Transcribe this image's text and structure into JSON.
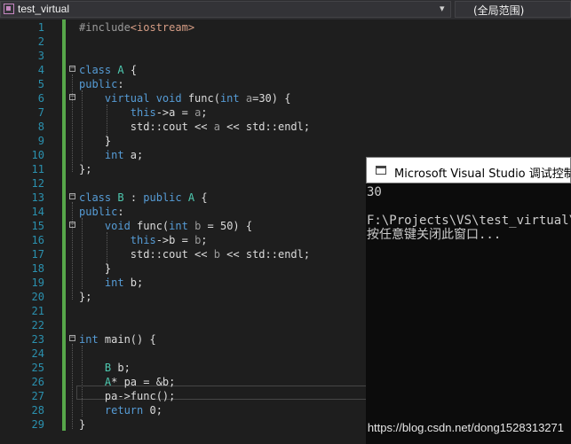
{
  "nav": {
    "file": "test_virtual",
    "scope": "(全局范围)",
    "dropdown_arrow": "▾"
  },
  "editor": {
    "line_numbers": [
      "1",
      "2",
      "3",
      "4",
      "5",
      "6",
      "7",
      "8",
      "9",
      "10",
      "11",
      "12",
      "13",
      "14",
      "15",
      "16",
      "17",
      "18",
      "19",
      "20",
      "21",
      "22",
      "23",
      "24",
      "25",
      "26",
      "27",
      "28",
      "29"
    ],
    "lines": [
      [
        [
          "#include",
          "#9b9b9b"
        ],
        [
          "<iostream>",
          "#d69d85"
        ]
      ],
      [],
      [],
      [
        [
          "class ",
          "#569cd6"
        ],
        [
          "A",
          "#4ec9b0"
        ],
        [
          " {",
          "#dcdcdc"
        ]
      ],
      [
        [
          "public",
          "#569cd6"
        ],
        [
          ":",
          "#dcdcdc"
        ]
      ],
      [
        [
          "    virtual ",
          "#569cd6"
        ],
        [
          "void ",
          "#569cd6"
        ],
        [
          "func(",
          "#dcdcdc"
        ],
        [
          "int ",
          "#569cd6"
        ],
        [
          "a",
          "#9a9a9a"
        ],
        [
          "=30) {",
          "#dcdcdc"
        ]
      ],
      [
        [
          "        this",
          "#569cd6"
        ],
        [
          "->a = ",
          "#dcdcdc"
        ],
        [
          "a",
          "#9a9a9a"
        ],
        [
          ";",
          "#dcdcdc"
        ]
      ],
      [
        [
          "        std::cout << ",
          "#dcdcdc"
        ],
        [
          "a",
          "#9a9a9a"
        ],
        [
          " << std::endl;",
          "#dcdcdc"
        ]
      ],
      [
        [
          "    }",
          "#dcdcdc"
        ]
      ],
      [
        [
          "    int ",
          "#569cd6"
        ],
        [
          "a;",
          "#dcdcdc"
        ]
      ],
      [
        [
          "};",
          "#dcdcdc"
        ]
      ],
      [],
      [
        [
          "class ",
          "#569cd6"
        ],
        [
          "B",
          "#4ec9b0"
        ],
        [
          " : ",
          "#dcdcdc"
        ],
        [
          "public ",
          "#569cd6"
        ],
        [
          "A",
          "#4ec9b0"
        ],
        [
          " {",
          "#dcdcdc"
        ]
      ],
      [
        [
          "public",
          "#569cd6"
        ],
        [
          ":",
          "#dcdcdc"
        ]
      ],
      [
        [
          "    void ",
          "#569cd6"
        ],
        [
          "func(",
          "#dcdcdc"
        ],
        [
          "int ",
          "#569cd6"
        ],
        [
          "b",
          "#9a9a9a"
        ],
        [
          " = 50) {",
          "#dcdcdc"
        ]
      ],
      [
        [
          "        this",
          "#569cd6"
        ],
        [
          "->b = ",
          "#dcdcdc"
        ],
        [
          "b",
          "#9a9a9a"
        ],
        [
          ";",
          "#dcdcdc"
        ]
      ],
      [
        [
          "        std::cout << ",
          "#dcdcdc"
        ],
        [
          "b",
          "#9a9a9a"
        ],
        [
          " << std::endl;",
          "#dcdcdc"
        ]
      ],
      [
        [
          "    }",
          "#dcdcdc"
        ]
      ],
      [
        [
          "    int ",
          "#569cd6"
        ],
        [
          "b;",
          "#dcdcdc"
        ]
      ],
      [
        [
          "};",
          "#dcdcdc"
        ]
      ],
      [],
      [],
      [
        [
          "int ",
          "#569cd6"
        ],
        [
          "main() {",
          "#dcdcdc"
        ]
      ],
      [],
      [
        [
          "    B",
          "#4ec9b0"
        ],
        [
          " b;",
          "#dcdcdc"
        ]
      ],
      [
        [
          "    A",
          "#4ec9b0"
        ],
        [
          "* pa = &b;",
          "#dcdcdc"
        ]
      ],
      [
        [
          "    pa->func();",
          "#dcdcdc"
        ]
      ],
      [
        [
          "    return ",
          "#569cd6"
        ],
        [
          "0;",
          "#dcdcdc"
        ]
      ],
      [
        [
          "}",
          "#dcdcdc"
        ]
      ]
    ]
  },
  "console": {
    "title": "Microsoft Visual Studio 调试控制台",
    "lines": [
      "30",
      "",
      "F:\\Projects\\VS\\test_virtual\\D",
      "按任意键关闭此窗口..."
    ]
  },
  "watermark": "https://blog.csdn.net/dong1528313271"
}
